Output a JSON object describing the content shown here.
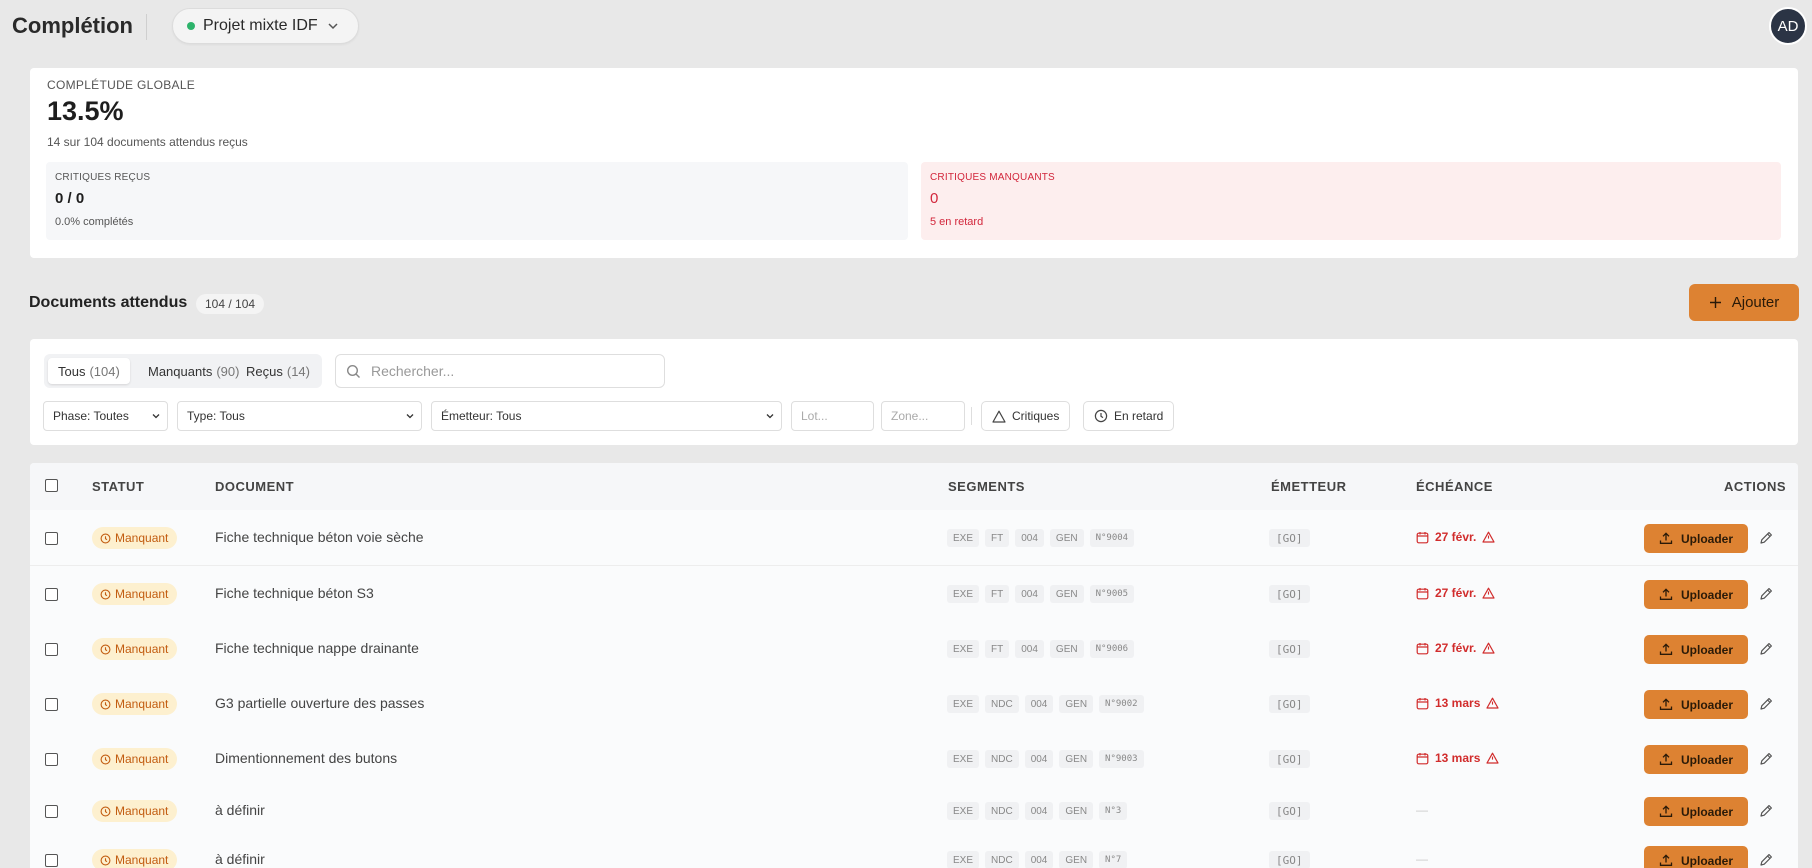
{
  "header": {
    "title": "Complétion",
    "project": "Projet mixte IDF",
    "avatar": "AD"
  },
  "summary": {
    "label": "COMPLÉTUDE GLOBALE",
    "value": "13.5%",
    "sub": "14 sur 104 documents attendus reçus",
    "received": {
      "label": "CRITIQUES REÇUS",
      "value": "0 / 0",
      "sub": "0.0% complétés"
    },
    "missing": {
      "label": "CRITIQUES MANQUANTS",
      "value": "0",
      "sub": "5 en retard"
    }
  },
  "section": {
    "title": "Documents attendus",
    "count": "104 / 104",
    "add_label": "Ajouter"
  },
  "filters": {
    "tabs": [
      {
        "label": "Tous",
        "count": "(104)"
      },
      {
        "label": "Manquants",
        "count": "(90)"
      },
      {
        "label": "Reçus",
        "count": "(14)"
      }
    ],
    "search_placeholder": "Rechercher...",
    "phase": "Phase: Toutes",
    "type": "Type: Tous",
    "emetteur": "Émetteur: Tous",
    "lot_placeholder": "Lot...",
    "zone_placeholder": "Zone...",
    "critiques": "Critiques",
    "en_retard": "En retard"
  },
  "table": {
    "headers": {
      "statut": "STATUT",
      "document": "DOCUMENT",
      "segments": "SEGMENTS",
      "emetteur": "ÉMETTEUR",
      "echeance": "ÉCHÉANCE",
      "actions": "ACTIONS"
    },
    "upload_label": "Uploader",
    "rows": [
      {
        "status": "Manquant",
        "document": "Fiche technique béton voie sèche",
        "segments": [
          "EXE",
          "FT",
          "004",
          "GEN",
          "N°9004"
        ],
        "emetteur": "[GO]",
        "due": "27 févr."
      },
      {
        "status": "Manquant",
        "document": "Fiche technique béton S3",
        "segments": [
          "EXE",
          "FT",
          "004",
          "GEN",
          "N°9005"
        ],
        "emetteur": "[GO]",
        "due": "27 févr."
      },
      {
        "status": "Manquant",
        "document": "Fiche technique nappe drainante",
        "segments": [
          "EXE",
          "FT",
          "004",
          "GEN",
          "N°9006"
        ],
        "emetteur": "[GO]",
        "due": "27 févr."
      },
      {
        "status": "Manquant",
        "document": "G3 partielle ouverture des passes",
        "segments": [
          "EXE",
          "NDC",
          "004",
          "GEN",
          "N°9002"
        ],
        "emetteur": "[GO]",
        "due": "13 mars"
      },
      {
        "status": "Manquant",
        "document": "Dimentionnement des butons",
        "segments": [
          "EXE",
          "NDC",
          "004",
          "GEN",
          "N°9003"
        ],
        "emetteur": "[GO]",
        "due": "13 mars"
      },
      {
        "status": "Manquant",
        "document": "à définir",
        "segments": [
          "EXE",
          "NDC",
          "004",
          "GEN",
          "N°3"
        ],
        "emetteur": "[GO]",
        "due": "—"
      },
      {
        "status": "Manquant",
        "document": "à définir",
        "segments": [
          "EXE",
          "NDC",
          "004",
          "GEN",
          "N°7"
        ],
        "emetteur": "[GO]",
        "due": "—"
      }
    ]
  },
  "colors": {
    "accent": "#dd8232",
    "danger": "#d12c2c",
    "status_bg": "#fdf0cf",
    "status_fg": "#c25c10"
  }
}
